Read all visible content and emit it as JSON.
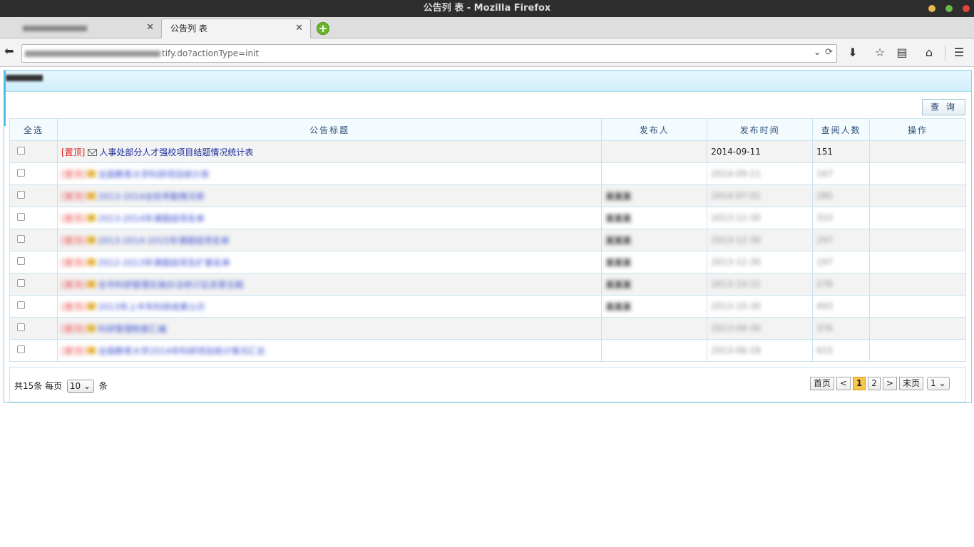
{
  "window": {
    "title": "公告列 表 - Mozilla Firefox",
    "dot_colors": [
      "#e8b84a",
      "#67b94c",
      "#e0443b"
    ]
  },
  "tabs": [
    {
      "label": "",
      "active": false
    },
    {
      "label": "公告列 表",
      "active": true
    }
  ],
  "address_bar": {
    "url_visible": "tify.do?actionType=init"
  },
  "toolbar_icons": [
    "download-icon",
    "bookmark-star-icon",
    "reading-list-icon",
    "home-icon",
    "hamburger-menu-icon"
  ],
  "page": {
    "query_button": "查 询",
    "columns": {
      "select_all": "全选",
      "title": "公告标题",
      "publisher": "发布人",
      "date": "发布时间",
      "views": "查阅人数",
      "actions": "操作"
    },
    "first_row": {
      "pin": "[置顶]",
      "title": "人事处部分人才强校项目结题情况统计表",
      "publisher": "",
      "date": "2014-09-11",
      "views": "151"
    },
    "blurred_rows": [
      {
        "pin": "[置顶]",
        "title": "全国教育大学科研项目统计表",
        "publisher": "",
        "date": "2014-09-11",
        "views": "167"
      },
      {
        "pin": "[置顶]",
        "title": "2013-2014全校考勤情况表",
        "publisher": "某某某",
        "date": "2014-07-01",
        "views": "285"
      },
      {
        "pin": "[置顶]",
        "title": "2013-2014年课题结项名单",
        "publisher": "某某某",
        "date": "2013-12-30",
        "views": "333"
      },
      {
        "pin": "[置顶]",
        "title": "2013-2014-2015年课题结项名单",
        "publisher": "某某某",
        "date": "2013-12-30",
        "views": "297"
      },
      {
        "pin": "[置顶]",
        "title": "2012-2013年课题结项及扩展名单",
        "publisher": "某某某",
        "date": "2013-12-30",
        "views": "197"
      },
      {
        "pin": "[置顶]",
        "title": "全市科研管理实施办法修订征求意见稿",
        "publisher": "某某某",
        "date": "2013-10-21",
        "views": "276"
      },
      {
        "pin": "[置顶]",
        "title": "2013年上半年科研成果公示",
        "publisher": "某某某",
        "date": "2013-10-30",
        "views": "493"
      },
      {
        "pin": "[置顶]",
        "title": "科研管理制度汇编",
        "publisher": "",
        "date": "2013-09-30",
        "views": "376"
      },
      {
        "pin": "[置顶]",
        "title": "全国教育大学2014年科研项目统计情况汇总",
        "publisher": "",
        "date": "2013-06-18",
        "views": "615"
      }
    ],
    "footer": {
      "total_prefix": "共15条 每页",
      "page_size": "10",
      "total_suffix": "条",
      "first": "首页",
      "prev": "<",
      "pages": [
        "1",
        "2"
      ],
      "current_page": "1",
      "next": ">",
      "last": "末页",
      "jump_value": "1"
    }
  }
}
